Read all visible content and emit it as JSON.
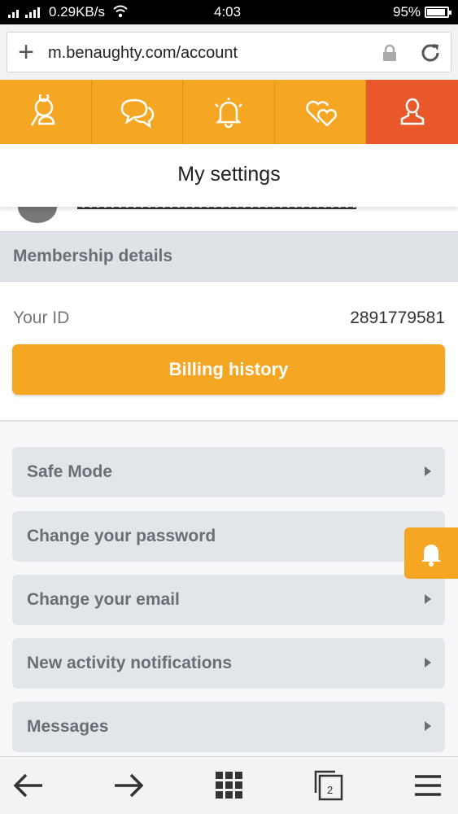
{
  "status_bar": {
    "speed": "0.29KB/s",
    "time": "4:03",
    "battery": "95%"
  },
  "browser": {
    "url": "m.benaughty.com/account",
    "tabs_count": "2"
  },
  "nav": {
    "tabs": [
      {
        "icon": "search-user-icon",
        "active": false
      },
      {
        "icon": "chat-icon",
        "active": false
      },
      {
        "icon": "bell-icon",
        "active": false
      },
      {
        "icon": "hearts-icon",
        "active": false
      },
      {
        "icon": "profile-icon",
        "active": true
      }
    ],
    "colors": {
      "tab": "#f5a623",
      "active": "#e8582b"
    }
  },
  "page": {
    "title": "My settings"
  },
  "membership": {
    "header": "Membership details",
    "id_label": "Your ID",
    "id_value": "2891779581",
    "billing_button": "Billing history"
  },
  "menu": {
    "items": [
      {
        "label": "Safe Mode"
      },
      {
        "label": "Change your password"
      },
      {
        "label": "Change your email"
      },
      {
        "label": "New activity notifications"
      },
      {
        "label": "Messages"
      }
    ]
  }
}
